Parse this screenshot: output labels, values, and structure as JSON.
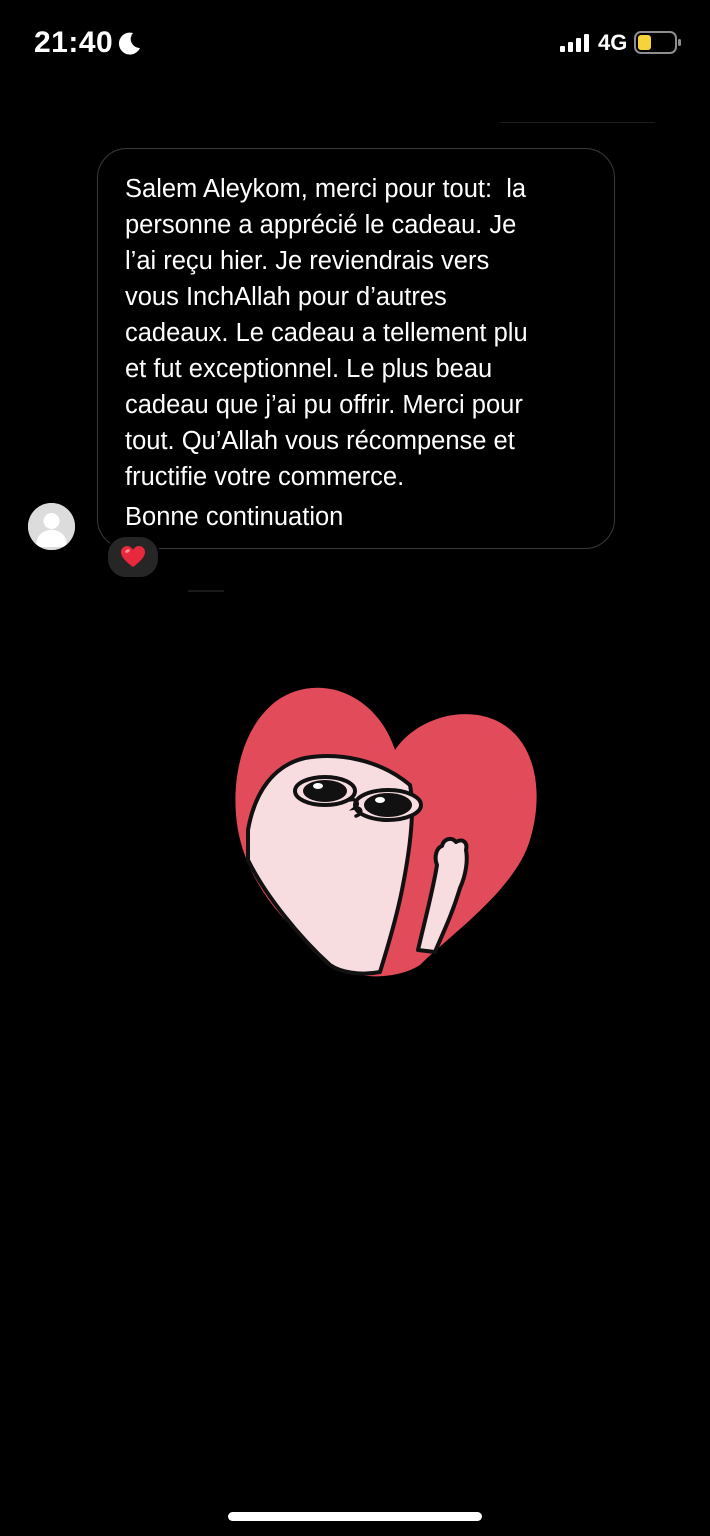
{
  "status_bar": {
    "time": "21:40",
    "network": "4G",
    "icons": [
      "moon-icon",
      "signal-icon",
      "battery-icon"
    ],
    "battery_color": "#f5d33b"
  },
  "message": {
    "body": "Salem Aleykom, merci pour tout:  la\npersonne a apprécié le cadeau. Je\nl’ai reçu hier. Je reviendrais vers\nvous InchAllah pour d’autres\ncadeaux. Le cadeau a tellement plu\net fut exceptionnel. Le plus beau\ncadeau que j’ai pu offrir. Merci pour\ntout. Qu’Allah vous récompense et\nfructifie votre commerce.",
    "signoff": "Bonne continuation",
    "reaction": "heart-emoji",
    "avatar": "default-avatar-icon"
  },
  "sticker": {
    "name": "heart-character-sticker",
    "heart_color": "#e24b5a",
    "character_color": "#f8dde0"
  }
}
